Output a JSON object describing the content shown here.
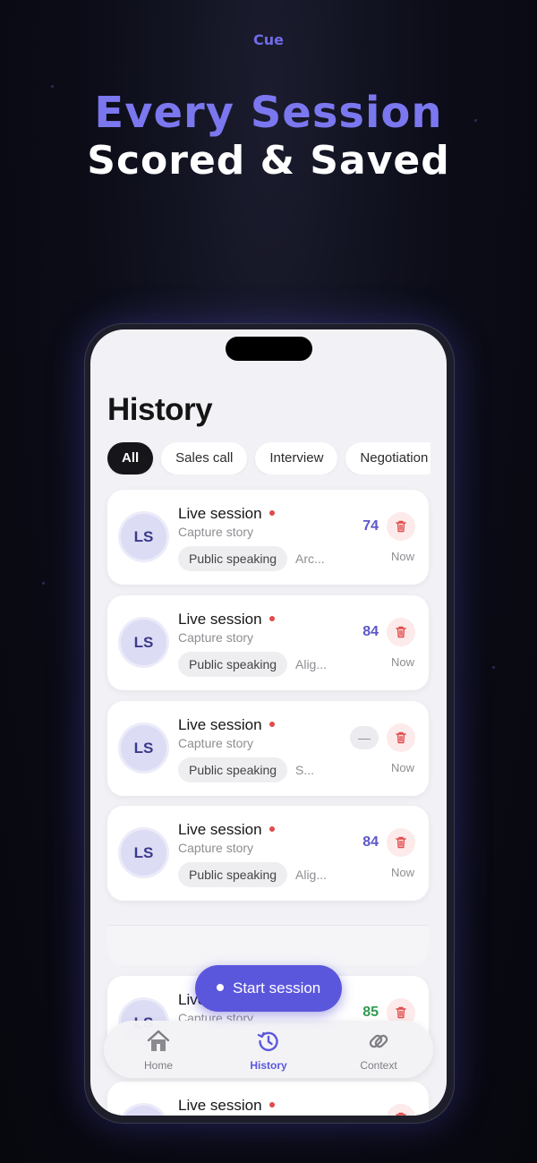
{
  "brand": "Cue",
  "headline": {
    "line1": "Every Session",
    "line2": "Scored & Saved"
  },
  "screen": {
    "title": "History",
    "filters": [
      {
        "label": "All",
        "active": true
      },
      {
        "label": "Sales call",
        "active": false
      },
      {
        "label": "Interview",
        "active": false
      },
      {
        "label": "Negotiation",
        "active": false
      }
    ],
    "sessions": [
      {
        "initials": "LS",
        "title": "Live session",
        "subtitle": "Capture story",
        "tag": "Public speaking",
        "extra": "Arc...",
        "score": "74",
        "time": "Now"
      },
      {
        "initials": "LS",
        "title": "Live session",
        "subtitle": "Capture story",
        "tag": "Public speaking",
        "extra": "Alig...",
        "score": "84",
        "time": "Now"
      },
      {
        "initials": "LS",
        "title": "Live session",
        "subtitle": "Capture story",
        "tag": "Public speaking",
        "extra": "S...",
        "score": "—",
        "time": "Now"
      },
      {
        "initials": "LS",
        "title": "Live session",
        "subtitle": "Capture story",
        "tag": "Public speaking",
        "extra": "Alig...",
        "score": "84",
        "time": "Now"
      },
      {
        "initials": "LS",
        "title": "Live session",
        "subtitle": "Capture story",
        "tag": "",
        "extra": "",
        "score": "85",
        "time": ""
      },
      {
        "initials": "LS",
        "title": "Live session",
        "subtitle": "",
        "tag": "",
        "extra": "",
        "score": "",
        "time": ""
      }
    ],
    "fab_label": "Start session",
    "tabs": [
      {
        "label": "Home",
        "icon": "home-icon",
        "active": false
      },
      {
        "label": "History",
        "icon": "history-icon",
        "active": true
      },
      {
        "label": "Context",
        "icon": "link-icon",
        "active": false
      }
    ]
  },
  "colors": {
    "accent": "#5b57dd",
    "score_blue": "#5b57c9",
    "score_green": "#2f9a4f",
    "live_dot": "#e04b4b"
  }
}
